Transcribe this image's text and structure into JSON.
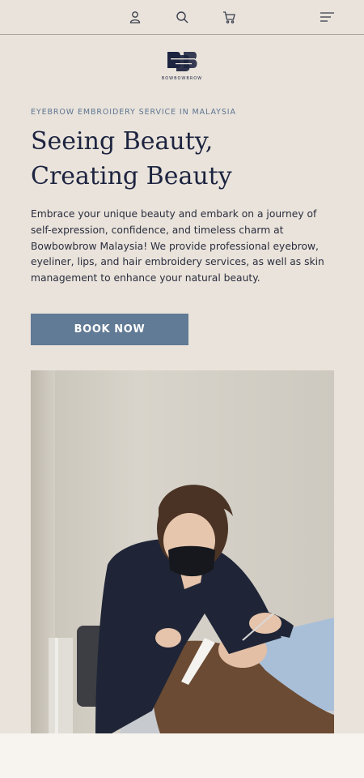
{
  "header": {
    "icons": [
      "user-icon",
      "search-icon",
      "cart-icon",
      "menu-icon"
    ]
  },
  "logo": {
    "wordmark": "BOWBOWBROW"
  },
  "hero": {
    "eyebrow": "EYEBROW EMBROIDERY SERVICE IN MALAYSIA",
    "headline_line1": "Seeing Beauty,",
    "headline_line2": "Creating Beauty",
    "intro": "Embrace your unique beauty and embark on a journey of self-expression, confidence, and timeless charm at Bowbowbrow Malaysia! We provide professional eyebrow, eyeliner, lips, and hair embroidery services, as well as skin management to enhance your natural beauty.",
    "cta_label": "BOOK NOW"
  },
  "colors": {
    "background": "#e9e3db",
    "accent_button": "#617a95",
    "text_dark": "#1d2440",
    "eyebrow_text": "#5e7591"
  }
}
